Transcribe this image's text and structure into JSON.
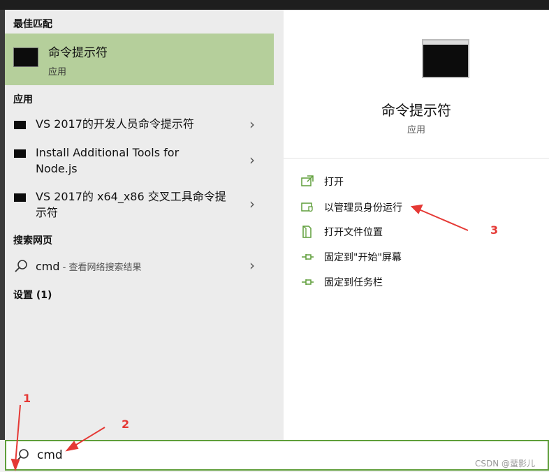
{
  "left": {
    "best_match_label": "最佳匹配",
    "best_match": {
      "title": "命令提示符",
      "subtitle": "应用"
    },
    "apps_label": "应用",
    "apps": [
      {
        "line1": "VS 2017的开发人员命令提示符",
        "line2": ""
      },
      {
        "line1": "Install Additional Tools for",
        "line2": "Node.js"
      },
      {
        "line1": "VS 2017的 x64_x86 交叉工具命令提",
        "line2": "示符"
      }
    ],
    "web_label": "搜索网页",
    "web_item": {
      "query": "cmd",
      "hint": " - 查看网络搜索结果"
    },
    "settings_label": "设置 (1)"
  },
  "right": {
    "title": "命令提示符",
    "subtitle": "应用",
    "actions": [
      {
        "label": "打开",
        "icon": "open-icon"
      },
      {
        "label": "以管理员身份运行",
        "icon": "run-as-admin-icon"
      },
      {
        "label": "打开文件位置",
        "icon": "file-location-icon"
      },
      {
        "label": "固定到\"开始\"屏幕",
        "icon": "pin-icon"
      },
      {
        "label": "固定到任务栏",
        "icon": "pin-icon"
      }
    ]
  },
  "search": {
    "value": "cmd"
  },
  "annotations": [
    "1",
    "2",
    "3"
  ],
  "watermark": "CSDN @蜚影儿",
  "colors": {
    "accent": "#5f9e3a",
    "selected": "#b5cf9b",
    "annotation": "#e53935"
  }
}
